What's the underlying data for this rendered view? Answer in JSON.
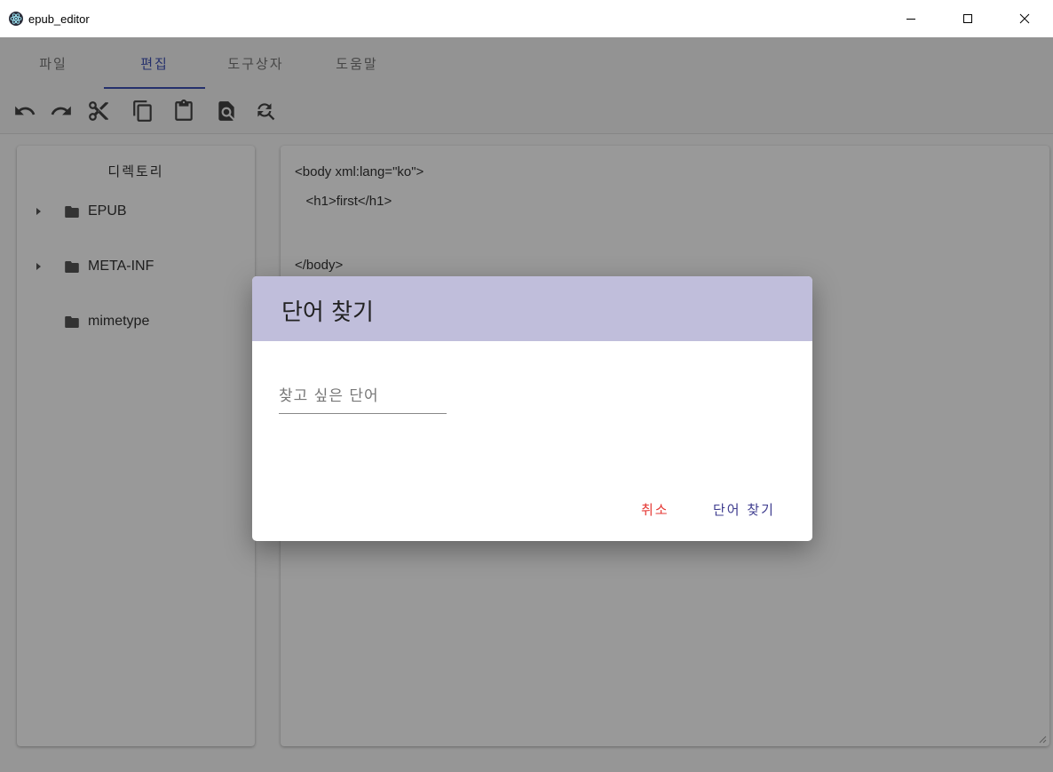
{
  "window": {
    "title": "epub_editor"
  },
  "menu": {
    "tabs": [
      {
        "label": "파일"
      },
      {
        "label": "편집"
      },
      {
        "label": "도구상자"
      },
      {
        "label": "도움말"
      }
    ],
    "active_tab": "편집"
  },
  "toolbar": {
    "icons": [
      "undo-icon",
      "redo-icon",
      "cut-icon",
      "copy-icon",
      "paste-icon",
      "find-icon",
      "replace-icon"
    ]
  },
  "directory": {
    "title": "디렉토리",
    "items": [
      {
        "label": "EPUB",
        "expandable": true
      },
      {
        "label": "META-INF",
        "expandable": true
      },
      {
        "label": "mimetype",
        "expandable": false
      }
    ]
  },
  "editor": {
    "lines": [
      "<body xml:lang=\"ko\">",
      "   <h1>first</h1>",
      "",
      "</body>"
    ]
  },
  "dialog": {
    "title": "단어 찾기",
    "input_placeholder": "찾고 싶은 단어",
    "input_value": "",
    "cancel_label": "취소",
    "confirm_label": "단어 찾기"
  },
  "colors": {
    "accent": "#3f51b5",
    "dialog_header": "#c0bedb",
    "cancel": "#e53935",
    "confirm": "#3f3d8f"
  }
}
